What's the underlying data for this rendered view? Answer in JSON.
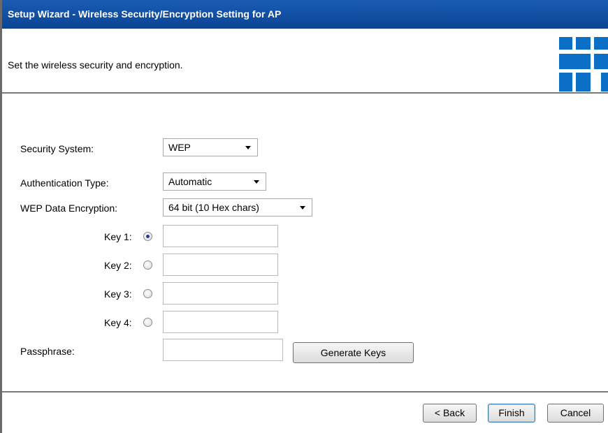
{
  "window": {
    "title": "Setup Wizard - Wireless Security/Encryption Setting for AP"
  },
  "header": {
    "description": "Set the wireless security and encryption.",
    "logo_color": "#0b6fc6"
  },
  "form": {
    "security_system": {
      "label": "Security System:",
      "value": "WEP"
    },
    "authentication_type": {
      "label": "Authentication Type:",
      "value": "Automatic"
    },
    "wep_data_encryption": {
      "label": "WEP Data Encryption:",
      "value": "64 bit (10 Hex chars)"
    },
    "keys": [
      {
        "label": "Key 1:",
        "selected": true,
        "value": ""
      },
      {
        "label": "Key 2:",
        "selected": false,
        "value": ""
      },
      {
        "label": "Key 3:",
        "selected": false,
        "value": ""
      },
      {
        "label": "Key 4:",
        "selected": false,
        "value": ""
      }
    ],
    "passphrase": {
      "label": "Passphrase:",
      "value": ""
    },
    "generate_keys_label": "Generate Keys"
  },
  "footer": {
    "back_label": "< Back",
    "finish_label": "Finish",
    "cancel_label": "Cancel"
  },
  "colors": {
    "title_bar": "#0b4ea2"
  }
}
